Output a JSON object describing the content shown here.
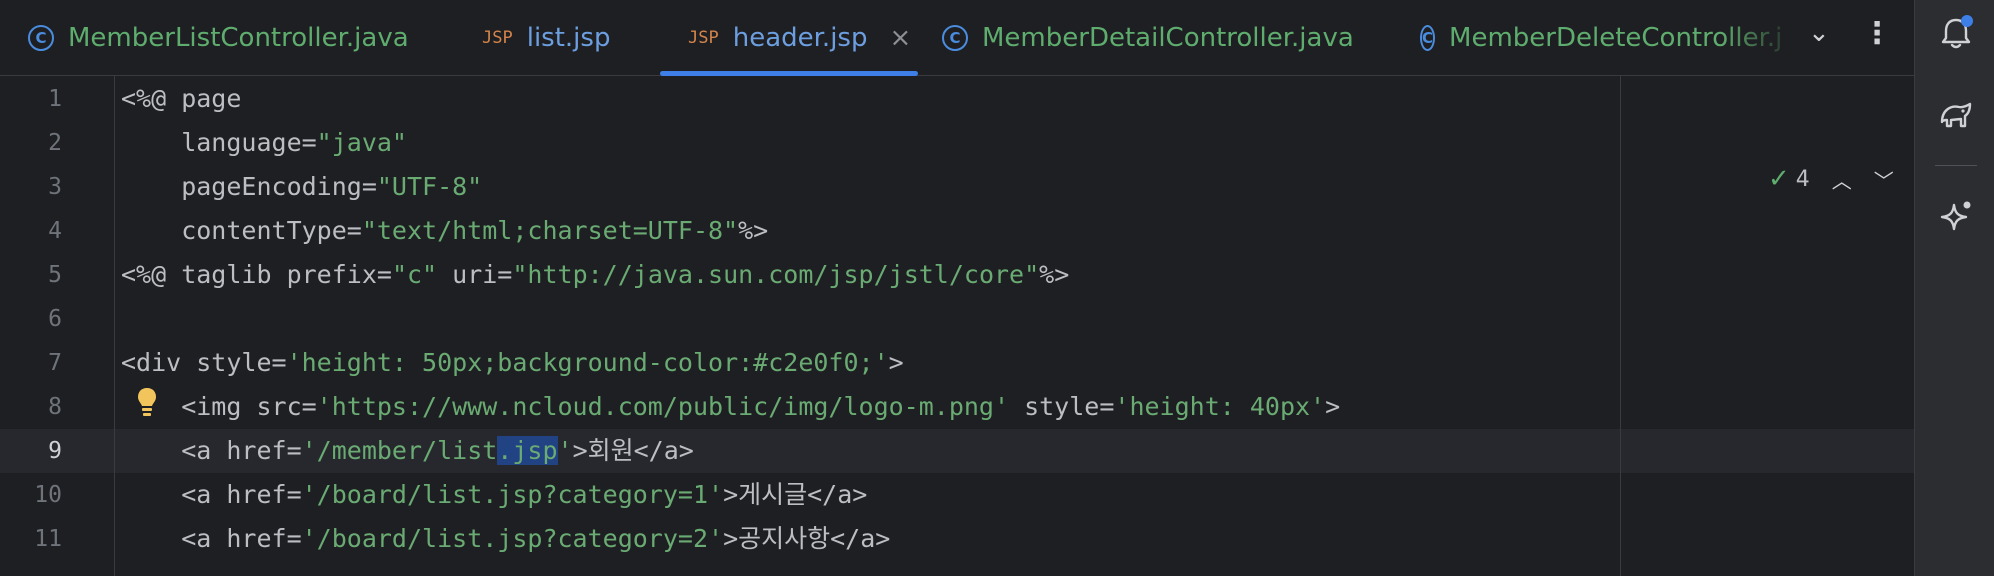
{
  "tabs": [
    {
      "label": "MemberListController.java",
      "type": "java",
      "icon": "class-icon"
    },
    {
      "label": "list.jsp",
      "type": "jsp",
      "icon": "jsp-file-icon"
    },
    {
      "label": "header.jsp",
      "type": "jsp",
      "icon": "jsp-file-icon",
      "active": true
    },
    {
      "label": "MemberDetailController.java",
      "type": "java",
      "icon": "class-icon"
    },
    {
      "label": "MemberDeleteController.java",
      "type": "java",
      "icon": "class-icon"
    }
  ],
  "icons": {
    "class": "C",
    "jsp": "JSP",
    "close": "×",
    "chevron": "⌄",
    "more": "⋮",
    "check": "✓",
    "up": "︿",
    "down": "﹀"
  },
  "inspection": {
    "count": "4"
  },
  "editor": {
    "current_line": "9",
    "lines": [
      {
        "n": "1",
        "t": "<%@ page"
      },
      {
        "n": "2",
        "a": "    language=",
        "b": "\"java\""
      },
      {
        "n": "3",
        "a": "    pageEncoding=",
        "b": "\"UTF-8\""
      },
      {
        "n": "4",
        "a": "    contentType=",
        "b": "\"text/html;charset=UTF-8\"",
        "c": "%>"
      },
      {
        "n": "5",
        "a": "<%@ taglib prefix=",
        "b": "\"c\"",
        "c": " uri=",
        "d": "\"http://java.sun.com/jsp/jstl/core\"",
        "e": "%>"
      },
      {
        "n": "6"
      },
      {
        "n": "7",
        "a": "<div style=",
        "b": "'height: 50px;background-color:#c2e0f0;'",
        "c": ">"
      },
      {
        "n": "8",
        "a": "    <img src=",
        "b": "'https://www.ncloud.com/public/img/logo-m.png'",
        "c": " style=",
        "d": "'height: 40px'",
        "e": ">"
      },
      {
        "n": "9",
        "a": "    <a href=",
        "b1": "'/member/list",
        "bsel": ".jsp",
        "b2": "'",
        "c": ">회원</a>"
      },
      {
        "n": "10",
        "a": "    <a href=",
        "b": "'/board/list.jsp?category=1'",
        "c": ">게시글</a>"
      },
      {
        "n": "11",
        "a": "    <a href=",
        "b": "'/board/list.jsp?category=2'",
        "c": ">공지사항</a>"
      }
    ]
  },
  "colors": {
    "accent": "#3d7fe6",
    "string": "#6aab73",
    "text": "#bcbec4",
    "java_tab": "#5fad6e",
    "jsp_tab": "#6c9ee0"
  }
}
